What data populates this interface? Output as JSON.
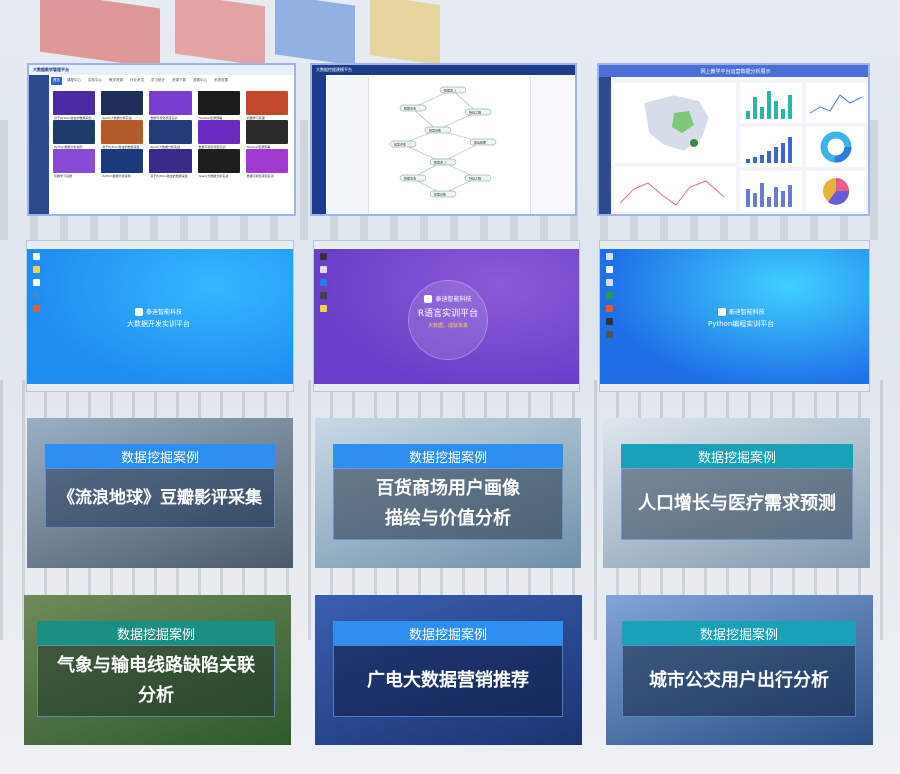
{
  "screenshots": {
    "course_platform": {
      "title": "大数据教学管理平台",
      "user": "管理员",
      "tabs": [
        "首页",
        "课程中心",
        "实验中心",
        "教学资源",
        "作业考试",
        "学习统计",
        "资源下载",
        "竞赛中心",
        "系统设置"
      ],
      "cards": [
        "基于Python爬虫的数据采集",
        "Spark大数据分析实战",
        "数据可视化项目实训",
        "Hadoop集群部署",
        "机器学习基础",
        "Python数据分析案例"
      ]
    },
    "flow_editor": {
      "title": "大数据挖掘建模平台",
      "nodes": [
        "数据源_1",
        "数据清洗",
        "特征工程",
        "模型训练",
        "模型评估",
        "输出结果"
      ]
    },
    "dashboard": {
      "title": "网上教学平台运营数据分析展示"
    }
  },
  "desktops": [
    {
      "brand": "泰迪智能科技",
      "platform": "大数据开发实训平台",
      "colors": {
        "bg1": "#1f8cf0",
        "bg2": "#35b7ff"
      }
    },
    {
      "brand": "泰迪智能科技",
      "platform": "R语言实训平台",
      "slogan": "大数据，成就未来",
      "colors": {
        "bg1": "#6a3fc8",
        "bg2": "#8b5ad8"
      }
    },
    {
      "brand": "泰迪智能科技",
      "platform": "Python编程实训平台",
      "colors": {
        "bg1": "#1f6fe6",
        "bg2": "#3fd0ff"
      }
    }
  ],
  "cases": [
    {
      "tag": "数据挖掘案例",
      "title_lines": [
        "《流浪地球》豆瓣影评采集"
      ],
      "tag_color": "#2f8ff0",
      "bg1": "#4a5a6a",
      "bg2": "#9ab0c4"
    },
    {
      "tag": "数据挖掘案例",
      "title_lines": [
        "百货商场用户画像",
        "描绘与价值分析"
      ],
      "tag_color": "#2f8ff0",
      "bg1": "#6d8fa8",
      "bg2": "#c9dae6"
    },
    {
      "tag": "数据挖掘案例",
      "title_lines": [
        "人口增长与医疗需求预测"
      ],
      "tag_color": "#1aa1b8",
      "bg1": "#7f98ad",
      "bg2": "#dfe7ee"
    },
    {
      "tag": "数据挖掘案例",
      "title_lines": [
        "气象与输电线路缺陷关联",
        "分析"
      ],
      "tag_color": "#1b8f83",
      "bg1": "#2e5a2c",
      "bg2": "#6f8a5a"
    },
    {
      "tag": "数据挖掘案例",
      "title_lines": [
        "广电大数据营销推荐"
      ],
      "tag_color": "#2f8ff0",
      "bg1": "#1b3472",
      "bg2": "#3a5fb0"
    },
    {
      "tag": "数据挖掘案例",
      "title_lines": [
        "城市公交用户出行分析"
      ],
      "tag_color": "#1aa1b8",
      "bg1": "#2a4f86",
      "bg2": "#7fa6d6"
    }
  ]
}
